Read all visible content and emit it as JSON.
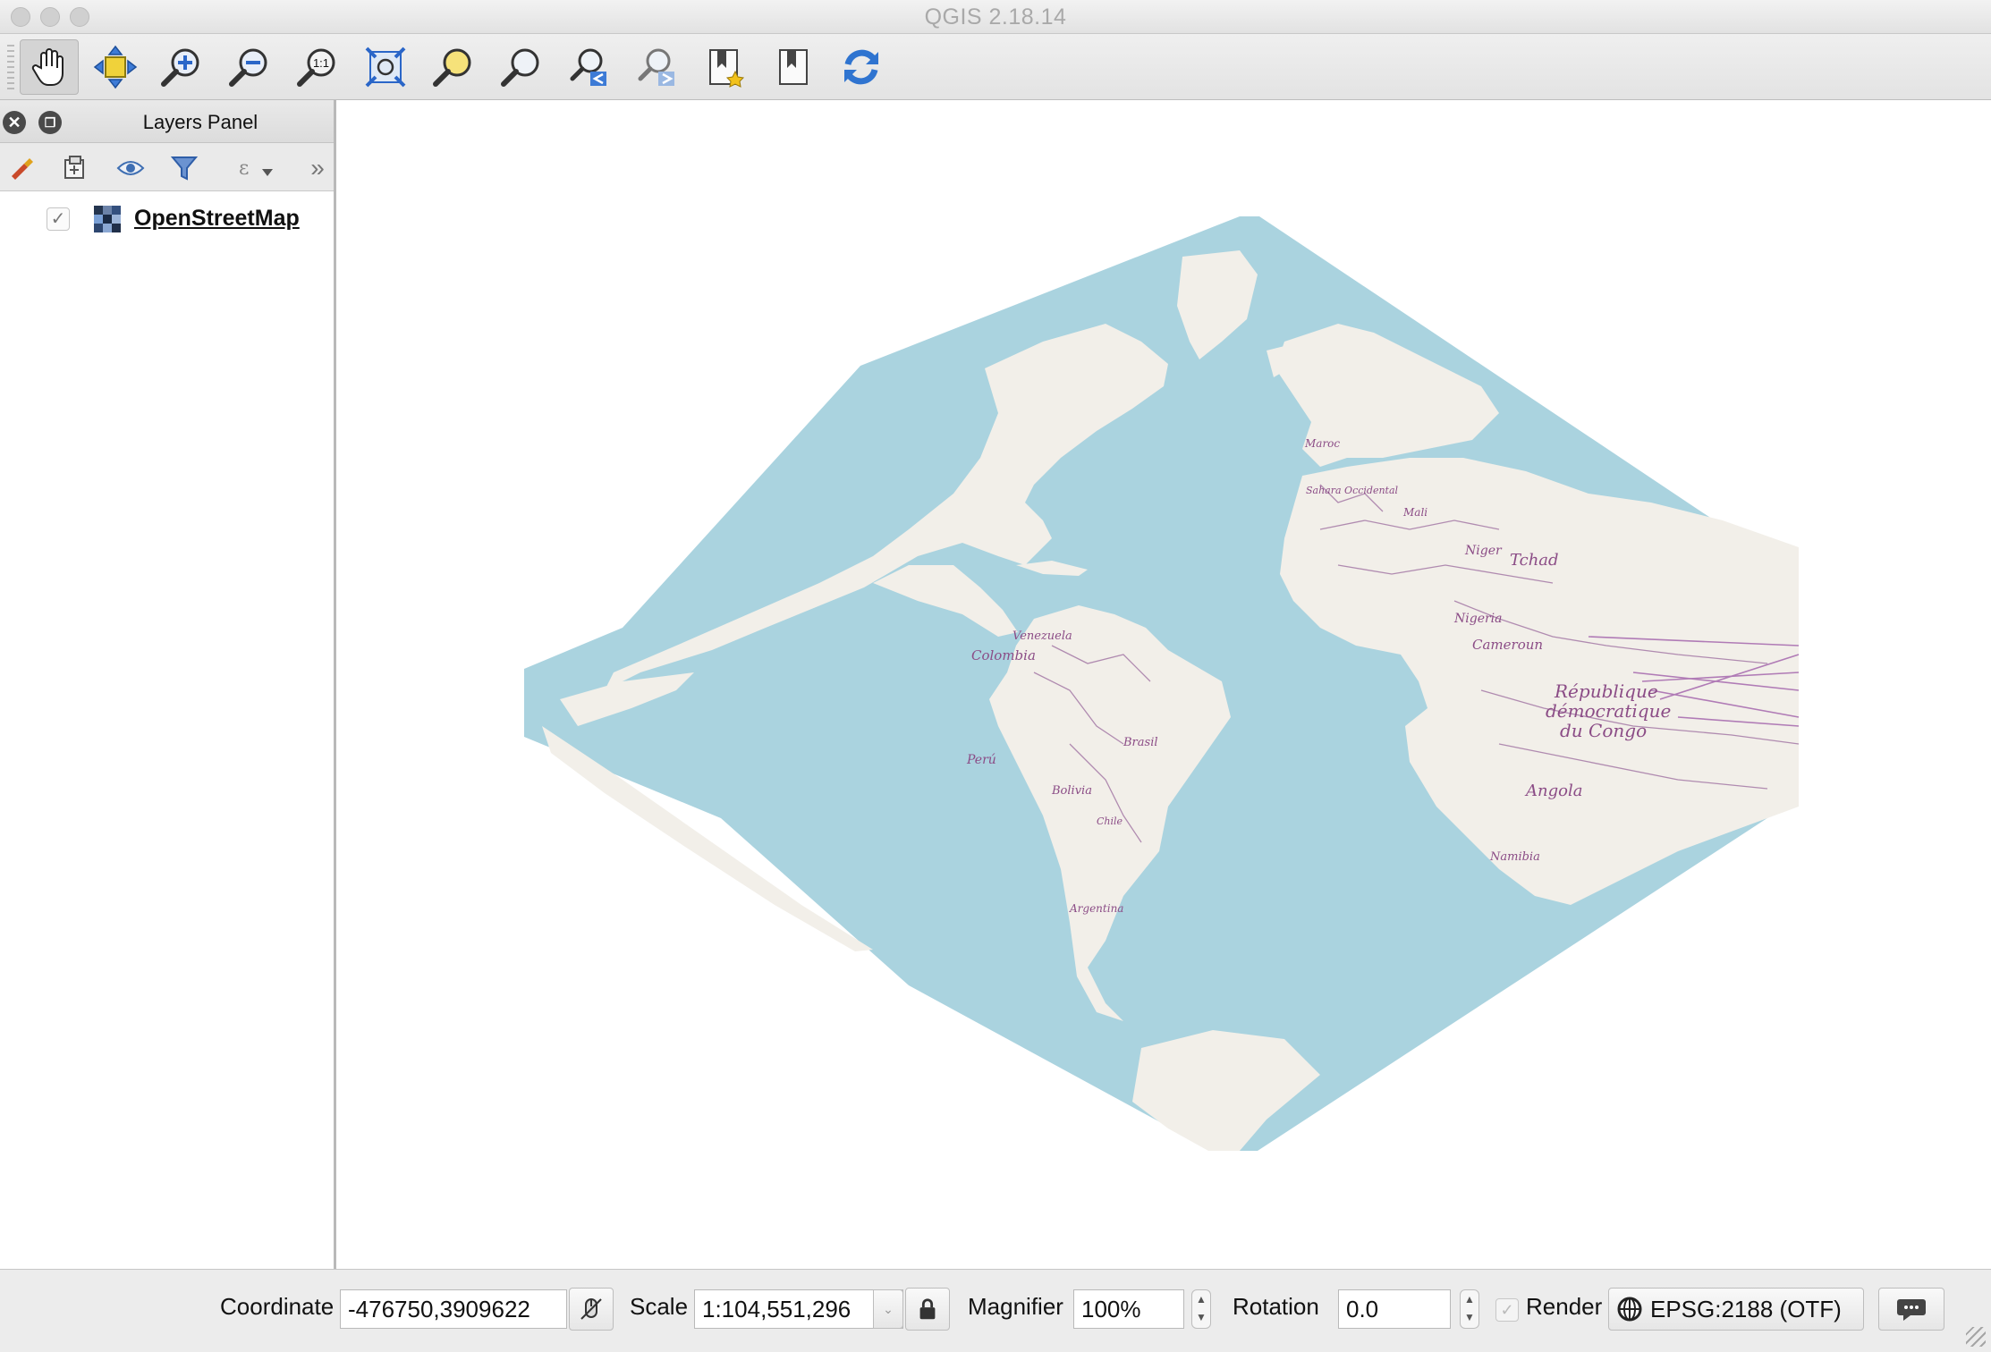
{
  "window": {
    "title": "QGIS 2.18.14"
  },
  "toolbar": {
    "buttons": [
      {
        "name": "pan-map-icon"
      },
      {
        "name": "pan-to-selection-icon"
      },
      {
        "name": "zoom-in-icon"
      },
      {
        "name": "zoom-out-icon"
      },
      {
        "name": "zoom-native-resolution-icon"
      },
      {
        "name": "zoom-full-icon"
      },
      {
        "name": "zoom-to-selection-icon"
      },
      {
        "name": "zoom-to-layer-icon"
      },
      {
        "name": "zoom-last-icon"
      },
      {
        "name": "zoom-next-icon"
      },
      {
        "name": "new-bookmark-icon"
      },
      {
        "name": "show-bookmarks-icon"
      },
      {
        "name": "refresh-icon"
      }
    ],
    "zoom_native_text": "1:1"
  },
  "layers_panel": {
    "title": "Layers Panel",
    "layers": [
      {
        "name": "OpenStreetMap",
        "checked": true,
        "check_mark": "✓"
      }
    ],
    "tools": [
      "style-brush-icon",
      "add-group-icon",
      "visibility-eye-icon",
      "filter-legend-icon",
      "expression-filter-icon",
      "more-chevron-icon"
    ],
    "more_label": "»"
  },
  "map": {
    "labels": {
      "venezuela": "Venezuela",
      "colombia": "Colombia",
      "peru": "Perú",
      "brasil": "Brasil",
      "bolivia": "Bolivia",
      "argentina": "Argentina",
      "chile": "Chile",
      "maroc": "Maroc",
      "mali": "Mali",
      "niger": "Niger",
      "chad": "Tchad",
      "nigeria": "Nigeria",
      "cameroun": "Cameroun",
      "drc1": "République",
      "drc2": "démocratique",
      "drc3": "du Congo",
      "angola": "Angola",
      "namibia": "Namibia",
      "sahara": "Sahara Occidental"
    },
    "colors": {
      "water": "#aad3df",
      "land": "#f2efe9",
      "border": "#b08bb0",
      "label": "#8b4c86"
    }
  },
  "statusbar": {
    "coordinate_label": "Coordinate",
    "coordinate_value": "-476750,3909622",
    "scale_label": "Scale",
    "scale_value": "1:104,551,296",
    "magnifier_label": "Magnifier",
    "magnifier_value": "100%",
    "rotation_label": "Rotation",
    "rotation_value": "0.0",
    "render_label": "Render",
    "render_checked": false,
    "crs_label": "EPSG:2188 (OTF)"
  }
}
